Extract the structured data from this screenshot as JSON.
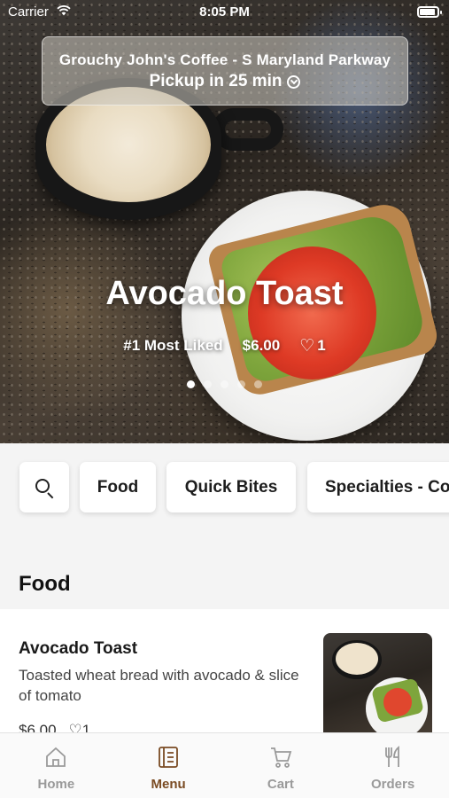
{
  "status_bar": {
    "carrier": "Carrier",
    "time": "8:05 PM",
    "battery_level": 0.9
  },
  "store": {
    "name": "Grouchy John's Coffee - S Maryland Parkway",
    "pickup": "Pickup in 25 min"
  },
  "hero": {
    "title": "Avocado Toast",
    "badge": "#1 Most Liked",
    "price": "$6.00",
    "likes": "1",
    "slide_count": 5,
    "active_slide": 1
  },
  "categories": [
    "Food",
    "Quick Bites",
    "Specialties - Co"
  ],
  "section": {
    "title": "Food"
  },
  "items": [
    {
      "name": "Avocado Toast",
      "description": "Toasted wheat bread with avocado & slice of tomato",
      "price": "$6.00",
      "likes": "1"
    }
  ],
  "tabs": [
    {
      "label": "Home",
      "icon": "home-icon"
    },
    {
      "label": "Menu",
      "icon": "menu-icon",
      "active": true
    },
    {
      "label": "Cart",
      "icon": "cart-icon"
    },
    {
      "label": "Orders",
      "icon": "fork-knife-icon"
    }
  ],
  "colors": {
    "accent": "#7a4b23",
    "inactive_tab": "#9a9a9a"
  }
}
